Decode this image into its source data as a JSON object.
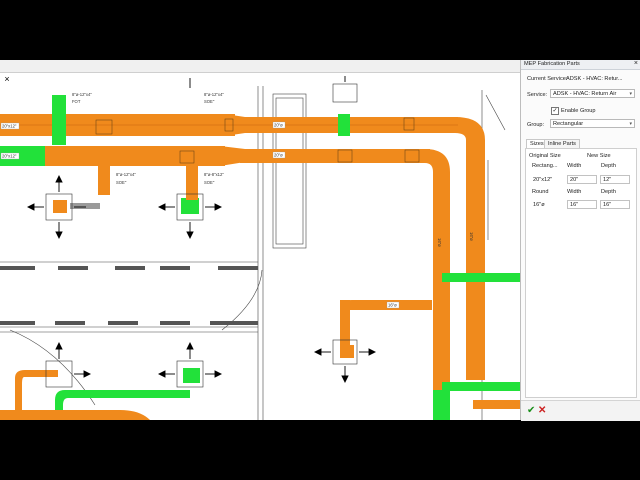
{
  "colors": {
    "duct_orange": "#f08a1c",
    "duct_orange_dark": "#c8650c",
    "duct_green": "#22e13a",
    "panel_bg": "#fbfbfb",
    "wall": "#333333"
  },
  "canvas": {
    "close_glyph": "×"
  },
  "drawing_labels": {
    "d1": "8\"ø-12\"x4\"",
    "d1b": "FOT",
    "d2": "8\"ø-12\"x4\"",
    "d2b": "SOE\"",
    "d3": "8\"ø-12\"x4\"",
    "d3b": "SOE\"",
    "d4": "8\"ø-8\"x12\"",
    "d4b": "SOE\"",
    "row1": "20\"x12\"",
    "row2": "20\"x12\"",
    "t1": "20\"ø",
    "t2": "20\"ø",
    "v1": "16\"ø",
    "v2": "16\"ø",
    "h1": "16\"ø"
  },
  "panel": {
    "title": "MEP Fabrication Parts",
    "close": "×",
    "current_service_label": "Current Service:",
    "current_service_value": "ADSK - HVAC: Retur...",
    "service_label": "Service:",
    "service_value": "ADSK - HVAC: Return Air",
    "enable_group_label": "Enable Group",
    "enable_group_checked": "✓",
    "group_label": "Group:",
    "group_value": "Rectangular",
    "tabs": [
      "Sizes",
      "Inline Parts"
    ],
    "original_size_header": "Original Size",
    "new_size_header": "New Size",
    "rect_label": "Rectang...",
    "width_header": "Width",
    "depth_header": "Depth",
    "rect_size": "20\"x12\"",
    "rect_width": "20\"",
    "rect_depth": "12\"",
    "round_label": "Round",
    "round_width_header": "Width",
    "round_depth_header": "Depth",
    "round_size": "16\"ø",
    "round_width": "16\"",
    "round_depth": "16\""
  }
}
